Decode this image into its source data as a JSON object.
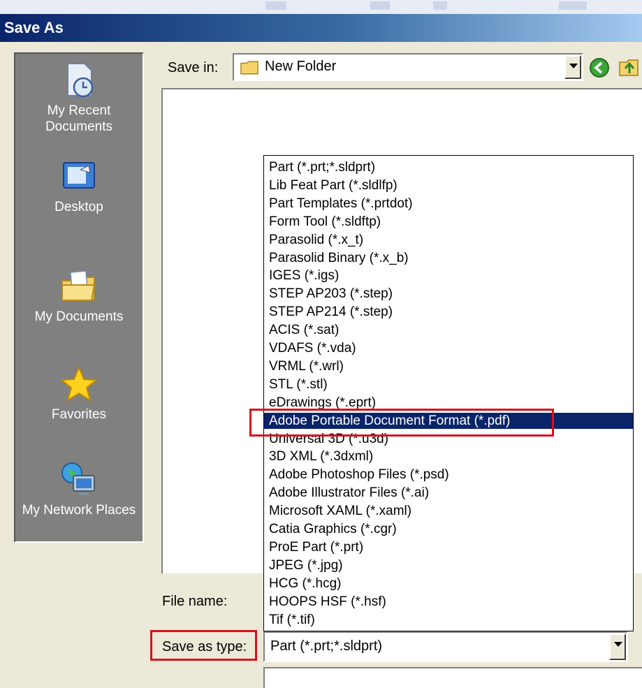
{
  "window": {
    "title": "Save As"
  },
  "places": [
    {
      "label": "My Recent Documents",
      "icon": "recent-documents-icon"
    },
    {
      "label": "Desktop",
      "icon": "desktop-icon"
    },
    {
      "label": "My Documents",
      "icon": "my-documents-icon"
    },
    {
      "label": "Favorites",
      "icon": "favorites-star-icon"
    },
    {
      "label": "My Network Places",
      "icon": "network-places-icon"
    }
  ],
  "save_in": {
    "label": "Save in:",
    "value": "New Folder"
  },
  "file_name": {
    "label": "File name:"
  },
  "save_as_type": {
    "label": "Save as type:",
    "value": "Part (*.prt;*.sldprt)"
  },
  "type_options": [
    "Part (*.prt;*.sldprt)",
    "Lib Feat Part (*.sldlfp)",
    "Part Templates (*.prtdot)",
    "Form Tool (*.sldftp)",
    "Parasolid (*.x_t)",
    "Parasolid Binary (*.x_b)",
    "IGES (*.igs)",
    "STEP AP203 (*.step)",
    "STEP AP214 (*.step)",
    "ACIS (*.sat)",
    "VDAFS (*.vda)",
    "VRML (*.wrl)",
    "STL (*.stl)",
    "eDrawings (*.eprt)",
    "Adobe Portable Document Format (*.pdf)",
    "Universal 3D (*.u3d)",
    "3D XML (*.3dxml)",
    "Adobe Photoshop Files (*.psd)",
    "Adobe Illustrator Files (*.ai)",
    "Microsoft XAML (*.xaml)",
    "Catia Graphics (*.cgr)",
    "ProE Part (*.prt)",
    "JPEG (*.jpg)",
    "HCG (*.hcg)",
    "HOOPS HSF (*.hsf)",
    "Tif (*.tif)"
  ],
  "selected_type_index": 14,
  "colors": {
    "title_bar": "#0a246a",
    "highlight": "#0a246a",
    "annotation": "#d7121e",
    "places_bar": "#808080"
  }
}
